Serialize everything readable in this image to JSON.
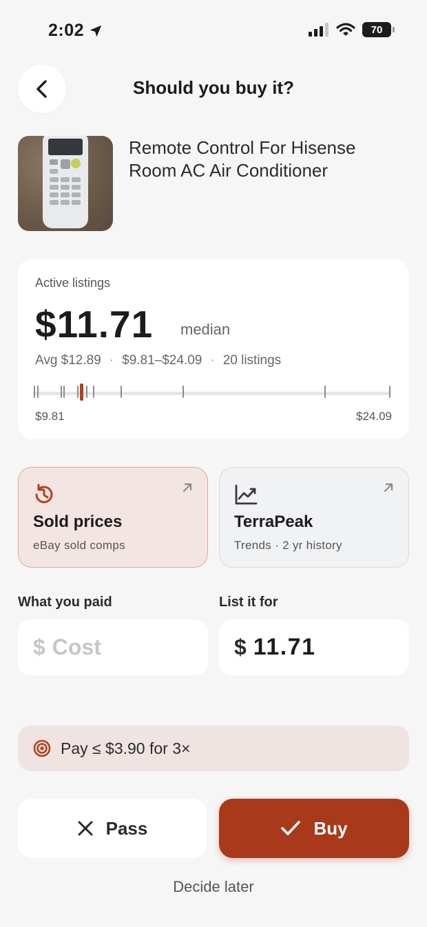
{
  "status_bar": {
    "time": "2:02",
    "battery": "70"
  },
  "header": {
    "title": "Should you buy it?"
  },
  "product": {
    "title": "Remote Control For Hisense Room AC Air Conditioner"
  },
  "active_listings": {
    "label": "Active listings",
    "median_price": "$11.71",
    "median_label": "median",
    "avg": "Avg $12.89",
    "range": "$9.81–$24.09",
    "count": "20 listings",
    "separator": "·",
    "min_label": "$9.81",
    "max_label": "$24.09",
    "min": 9.81,
    "max": 24.09,
    "median": 11.71,
    "listing_prices": [
      9.81,
      9.95,
      10.9,
      11.0,
      11.55,
      11.9,
      12.2,
      13.3,
      15.8,
      21.5,
      24.09
    ]
  },
  "tools": {
    "sold": {
      "title": "Sold prices",
      "subtitle": "eBay sold comps"
    },
    "terrapeak": {
      "title": "TerraPeak",
      "subtitle": "Trends · 2 yr history"
    }
  },
  "inputs": {
    "paid_label": "What you paid",
    "cost_placeholder": "Cost",
    "currency": "$",
    "list_label": "List it for",
    "list_value": "11.71"
  },
  "target": {
    "text": "Pay ≤ $3.90 for 3×"
  },
  "actions": {
    "pass": "Pass",
    "buy": "Buy",
    "decide_later": "Decide later"
  },
  "colors": {
    "accent": "#a8391b",
    "sold_card_bg": "#f3e6e2",
    "banner_bg": "#efe4e1"
  }
}
